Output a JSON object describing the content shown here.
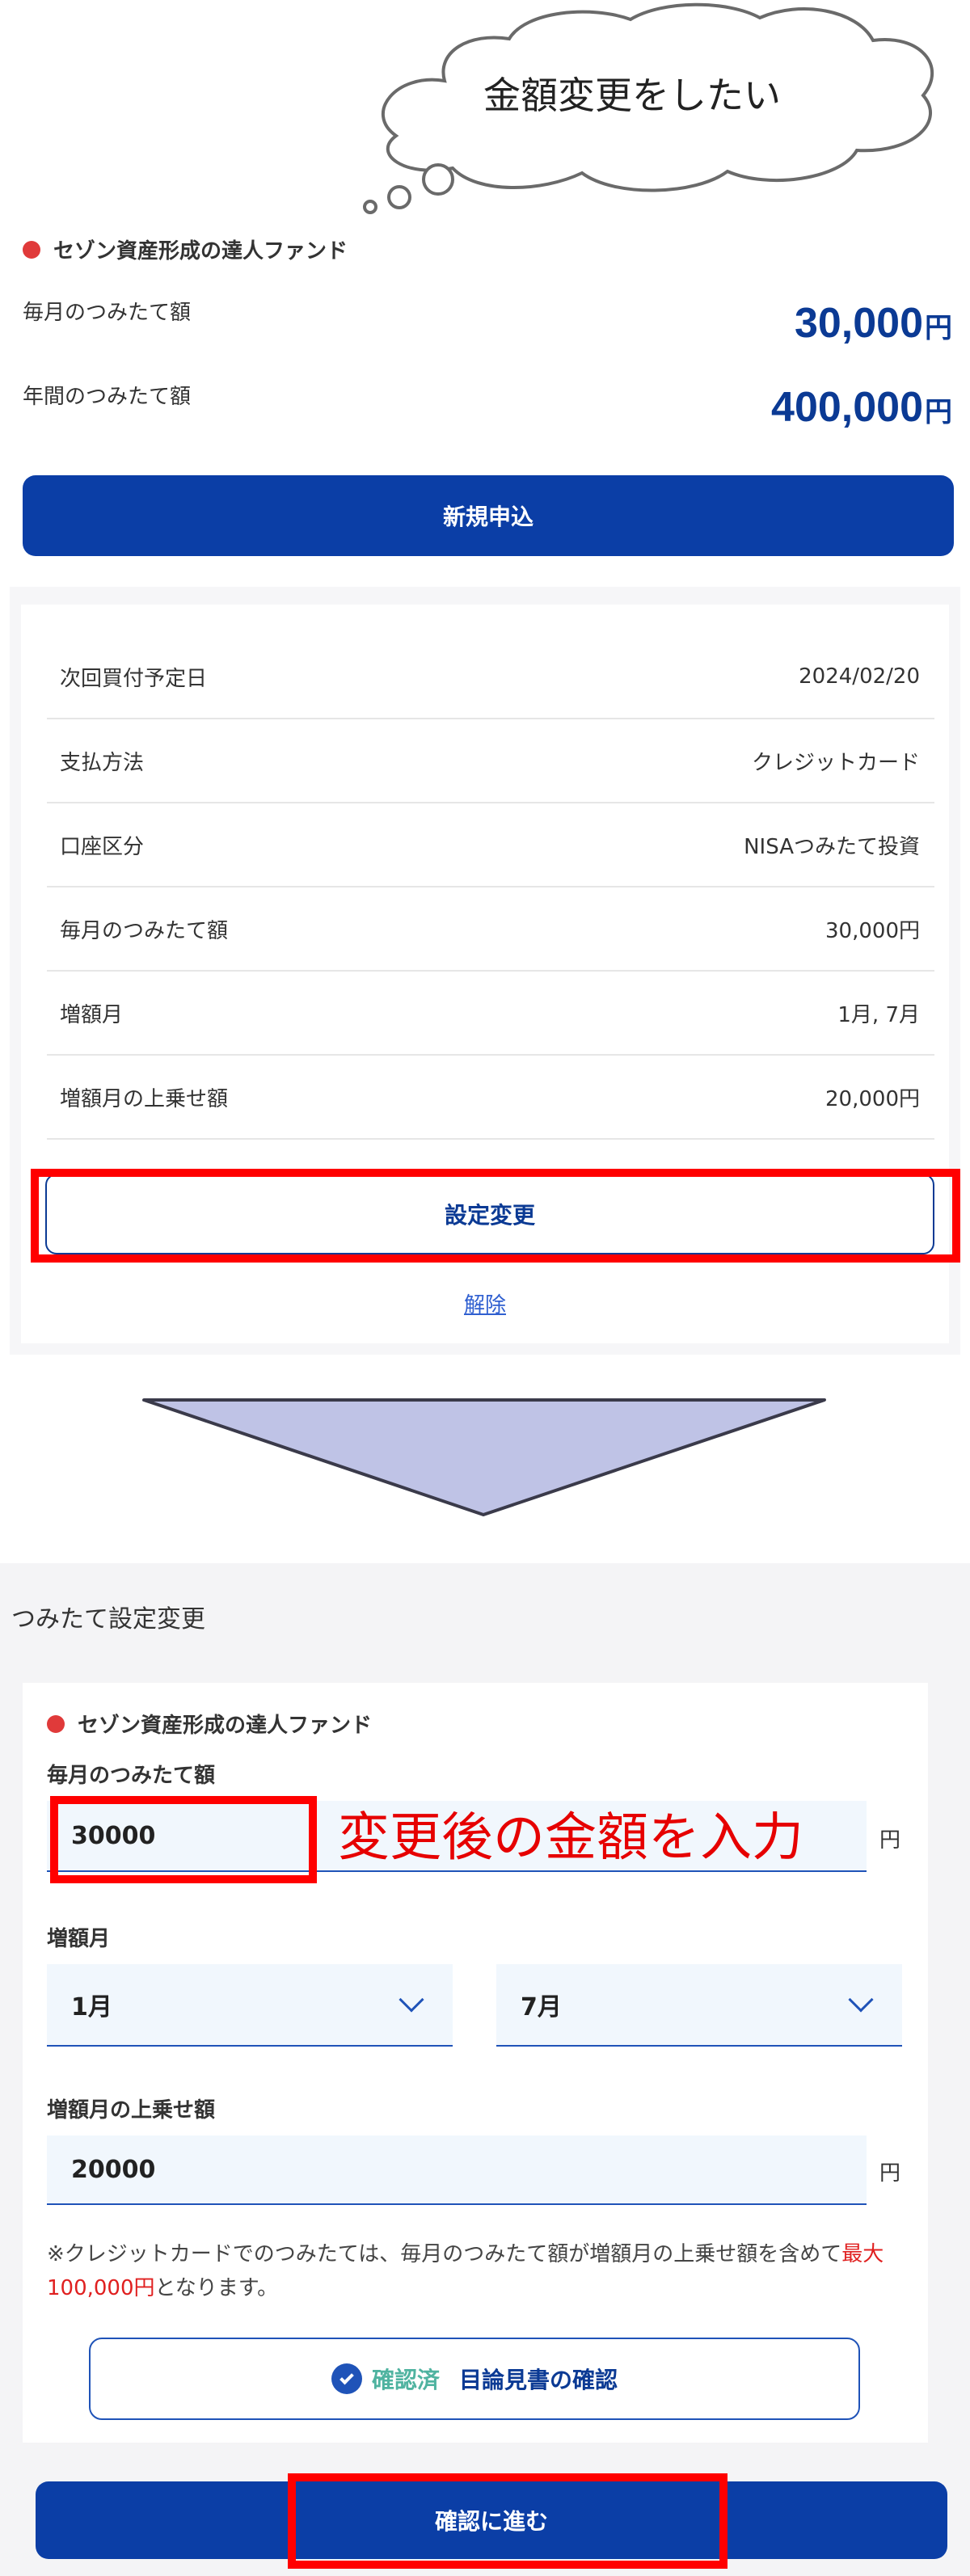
{
  "bubble": {
    "text": "金額変更をしたい"
  },
  "fund": {
    "name": "セゾン資産形成の達人ファンド",
    "monthly_label": "毎月のつみたて額",
    "monthly_value": "30,000",
    "annual_label": "年間のつみたて額",
    "annual_value": "400,000",
    "unit": "円"
  },
  "new_application_button": "新規申込",
  "details": [
    {
      "label": "次回買付予定日",
      "value": "2024/02/20"
    },
    {
      "label": "支払方法",
      "value": "クレジットカード"
    },
    {
      "label": "口座区分",
      "value": "NISAつみたて投資"
    },
    {
      "label": "毎月のつみたて額",
      "value": "30,000円"
    },
    {
      "label": "増額月",
      "value": "1月, 7月"
    },
    {
      "label": "増額月の上乗せ額",
      "value": "20,000円"
    }
  ],
  "settings_change_button": "設定変更",
  "cancel_link": "解除",
  "form": {
    "section_title": "つみたて設定変更",
    "fund_name": "セゾン資産形成の達人ファンド",
    "monthly_label": "毎月のつみたて額",
    "monthly_value": "30000",
    "yen": "円",
    "increase_month_label": "増額月",
    "increase_month_1": "1月",
    "increase_month_2": "7月",
    "addition_label": "増額月の上乗せ額",
    "addition_value": "20000",
    "note_part1": "※クレジットカードでのつみたては、毎月のつみたて額が増額月の上乗せ額を含めて",
    "note_red": "最大100,000円",
    "note_part2": "となります。",
    "confirmed_badge": "確認済",
    "prospectus_label": "目論見書の確認",
    "proceed_button": "確認に進む"
  },
  "annotation": {
    "text": "変更後の金額を入力"
  },
  "colors": {
    "primary": "#0b3ea6",
    "amount": "#0b3a94",
    "annotation_red": "#ff0000",
    "confirmed": "#4fb3a0",
    "arrow_fill": "#bfc3e6"
  }
}
